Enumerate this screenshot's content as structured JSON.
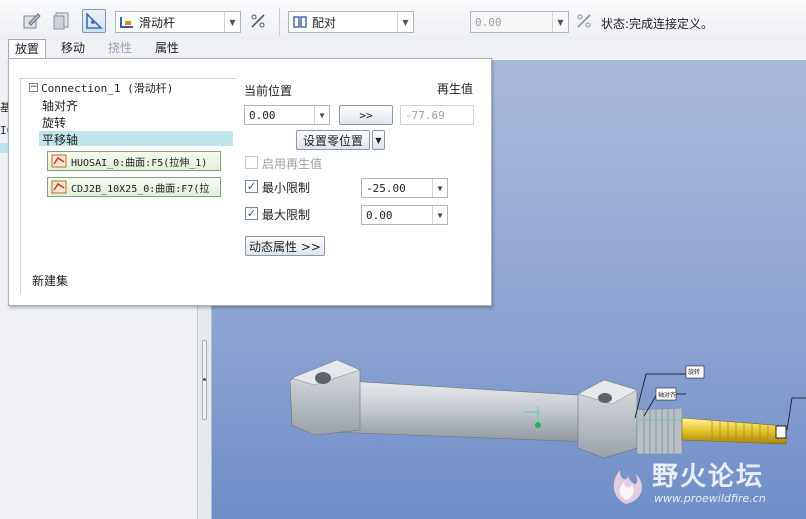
{
  "toolbar": {
    "mechanism_combo": "滑动杆",
    "constraint_combo": "配对",
    "offset_value": "0.00",
    "status_text": "状态:完成连接定义。"
  },
  "tabs": [
    {
      "label": "放置"
    },
    {
      "label": "移动"
    },
    {
      "label": "挠性"
    },
    {
      "label": "属性"
    }
  ],
  "tree": {
    "root_label": "Connection_1 (滑动杆)",
    "items": [
      "轴对齐",
      "旋转",
      "平移轴"
    ],
    "references": [
      "HUOSAI_0:曲面:F5(拉伸_1)",
      "CDJ2B_10X25_0:曲面:F7(拉"
    ],
    "new_set": "新建集"
  },
  "position": {
    "current_label": "当前位置",
    "regen_label": "再生值",
    "current_value": "0.00",
    "arrow_button": ">>",
    "regen_value": "-77.69",
    "set_zero_button": "设置零位置",
    "enable_regen_label": "启用再生值",
    "min_limit_label": "最小限制",
    "min_limit_value": "-25.00",
    "max_limit_label": "最大限制",
    "max_limit_value": "0.00",
    "dynamic_props_button": "动态属性 >>"
  },
  "model": {
    "label_1": "旋转",
    "label_2": "轴对齐"
  },
  "watermark": {
    "title": "野火论坛",
    "url": "www.proewildfire.cn"
  },
  "left_fragments": [
    "基",
    "IC"
  ]
}
